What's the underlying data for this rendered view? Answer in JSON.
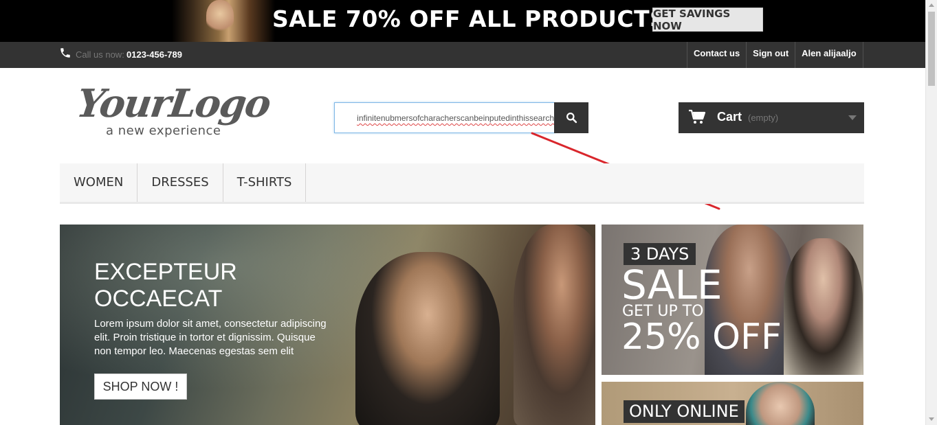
{
  "banner": {
    "headline": "SALE 70% OFF ALL PRODUCTS",
    "cta_label": "GET SAVINGS NOW"
  },
  "navbar": {
    "call_label": "Call us now:",
    "call_number": "0123-456-789",
    "links": [
      "Contact us",
      "Sign out",
      "Alen alijaaljo"
    ]
  },
  "logo": {
    "script": "YourLogo",
    "tagline": "a new experience"
  },
  "search": {
    "value": "infinitenubmersofcharacherscanbeinputedinthissearch"
  },
  "cart": {
    "label": "Cart",
    "status": "(empty)"
  },
  "menu": {
    "items": [
      "WOMEN",
      "DRESSES",
      "T-SHIRTS"
    ]
  },
  "hero": {
    "title": "EXCEPTEUR OCCAECAT",
    "text": "Lorem ipsum dolor sit amet, consectetur adipiscing elit. Proin tristique in tortor et dignissim. Quisque non tempor leo. Maecenas egestas sem elit",
    "button_label": "SHOP NOW !"
  },
  "promo_sale": {
    "badge": "3 DAYS",
    "headline": "SALE",
    "subline": "GET UP TO",
    "discount": "25% OFF"
  },
  "promo_online": {
    "badge": "ONLY ONLINE"
  },
  "colors": {
    "dark": "#333333",
    "annotation": "#d9262c",
    "search_focus": "#7fb7e6"
  }
}
